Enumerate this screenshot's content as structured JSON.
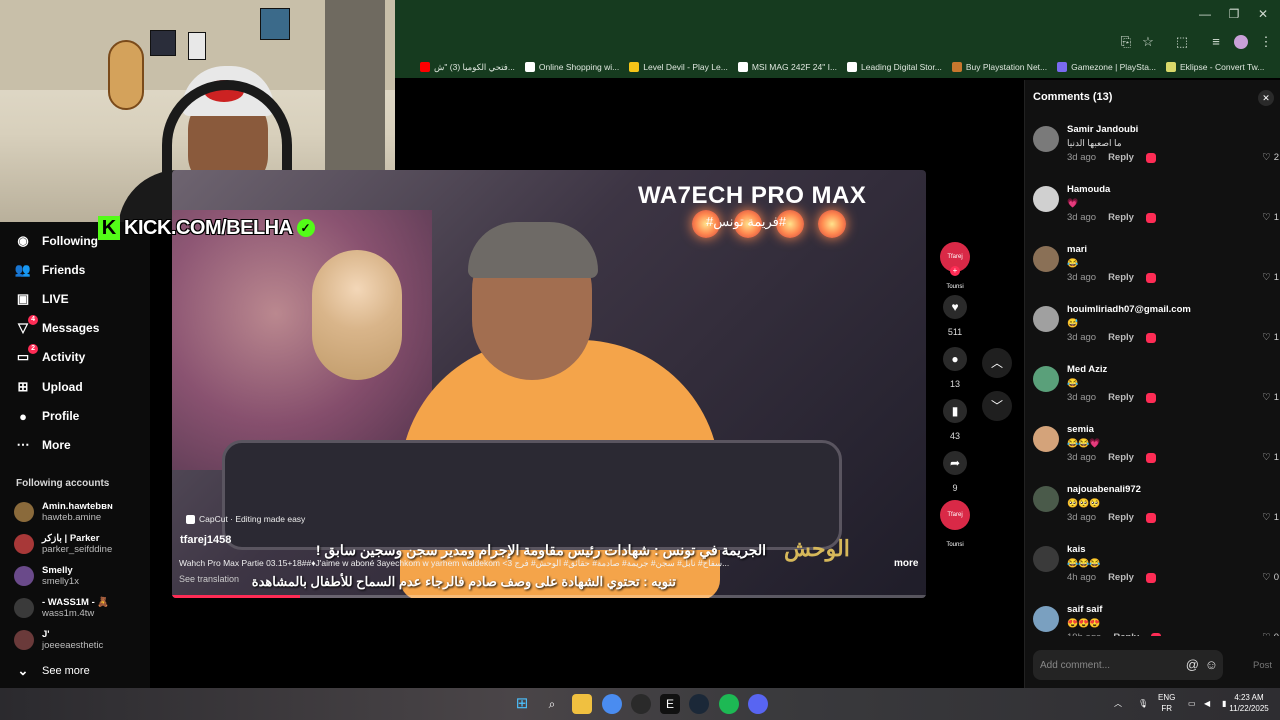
{
  "browser": {
    "bookmarks": [
      {
        "label": "فتحي الكومبا (3) \"ش...",
        "color": "#ff0000"
      },
      {
        "label": "Online Shopping wi...",
        "color": "#ffffff"
      },
      {
        "label": "Level Devil - Play Le...",
        "color": "#f5c518"
      },
      {
        "label": "MSI MAG 242F 24\" I...",
        "color": "#ffffff"
      },
      {
        "label": "Leading Digital Stor...",
        "color": "#ffffff"
      },
      {
        "label": "Buy Playstation Net...",
        "color": "#c8772e"
      },
      {
        "label": "Gamezone | PlaySta...",
        "color": "#7a6af0"
      },
      {
        "label": "Eklipse - Convert Tw...",
        "color": "#d9d96a"
      }
    ],
    "bookmarks_more": "»"
  },
  "webcam": {
    "overlay_text": "KICK.COM/BELHA",
    "kick_letter": "K"
  },
  "sidebar": {
    "items": [
      {
        "label": "Following",
        "icon": "avatar-icon",
        "badge": ""
      },
      {
        "label": "Friends",
        "icon": "friends-icon",
        "badge": ""
      },
      {
        "label": "LIVE",
        "icon": "live-icon",
        "badge": ""
      },
      {
        "label": "Messages",
        "icon": "messages-icon",
        "badge": "4"
      },
      {
        "label": "Activity",
        "icon": "activity-icon",
        "badge": "2"
      },
      {
        "label": "Upload",
        "icon": "upload-icon",
        "badge": ""
      },
      {
        "label": "Profile",
        "icon": "profile-icon",
        "badge": ""
      },
      {
        "label": "More",
        "icon": "more-icon",
        "badge": ""
      }
    ],
    "following_title": "Following accounts",
    "accounts": [
      {
        "name": "Amin.hawtebʙɴ",
        "user": "hawteb.amine",
        "color": "#8a6a3b"
      },
      {
        "name": "بازكر | Parker",
        "user": "parker_seifddine",
        "color": "#a83838"
      },
      {
        "name": "Smelly",
        "user": "smelly1x",
        "color": "#6a4a8a"
      },
      {
        "name": "- WASS1M - 🧸",
        "user": "wass1m.4tw",
        "color": "#3a3a3a"
      },
      {
        "name": "J'",
        "user": "joeeeaesthetic",
        "color": "#6a3a3a"
      }
    ],
    "see_more": "See more"
  },
  "video": {
    "stage_title": "WA7ECH PRO MAX",
    "stage_hashtag": "#فريمة تونس#",
    "show_logo": "الوحش",
    "caption_line1": "الجريمة في تونس : شهادات رئيس مقاومة الإجرام ومدير سجن وسجين سابق !",
    "caption_line2": "تنويه : تحتوي الشهادة على وصف صادم فالرجاء عدم السماح للأطفال بالمشاهدة",
    "capcut": "CapCut · Editing made easy",
    "author": "tfarej1458",
    "description": "Wahch Pro Max Partie 03.15+18##♦J'aime w aboné 3ayechkom w yarhem waldekom <3 سفاح# نابل# سجن# جريمة# صادمة# حقائق# الوحش# فرج...",
    "more": "more",
    "see_translation": "See translation",
    "progress": 0.17
  },
  "rail": {
    "creator_badge": "Tfarej Tounsi",
    "likes": "511",
    "comments": "13",
    "saves": "43",
    "shares": "9"
  },
  "comments": {
    "title": "Comments (13)",
    "items": [
      {
        "name": "Samir Jandoubi",
        "text": "ما اصعبها الدنيا",
        "time": "3d ago",
        "likes": "2",
        "color": "#7a7a7a"
      },
      {
        "name": "Hamouda",
        "text": "💗",
        "time": "3d ago",
        "likes": "1",
        "color": "#d0d0d0"
      },
      {
        "name": "mari",
        "text": "😂",
        "time": "3d ago",
        "likes": "1",
        "color": "#8a7056"
      },
      {
        "name": "houimliriadh07@gmail.com",
        "text": "😅",
        "time": "3d ago",
        "likes": "1",
        "color": "#a0a0a0"
      },
      {
        "name": "Med Aziz",
        "text": "😂",
        "time": "3d ago",
        "likes": "1",
        "color": "#5aa07a"
      },
      {
        "name": "semia",
        "text": "😂😂💗",
        "time": "3d ago",
        "likes": "1",
        "color": "#d4a37a"
      },
      {
        "name": "najouabenali972",
        "text": "🥺🥺🥺",
        "time": "3d ago",
        "likes": "1",
        "color": "#4a5a4a"
      },
      {
        "name": "kais",
        "text": "😂😂😂",
        "time": "4h ago",
        "likes": "0",
        "color": "#3a3a3a"
      },
      {
        "name": "saif saif",
        "text": "😍😍😍",
        "time": "19h ago",
        "likes": "0",
        "color": "#7aa0c0"
      }
    ],
    "reply_label": "Reply",
    "input_placeholder": "Add comment...",
    "post_label": "Post"
  },
  "taskbar": {
    "lang_top": "ENG",
    "lang_bottom": "FR",
    "time": "4:23 AM",
    "date": "11/22/2025"
  }
}
